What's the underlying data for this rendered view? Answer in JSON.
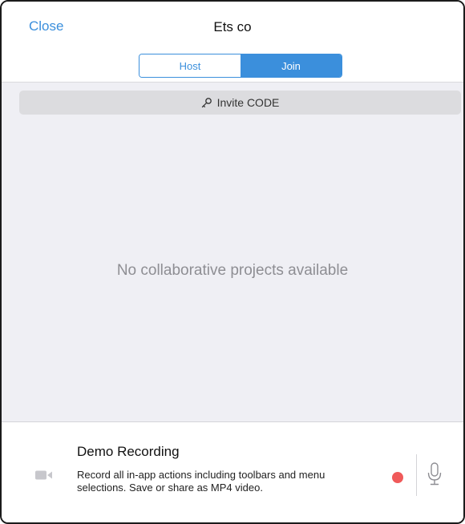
{
  "header": {
    "close_label": "Close",
    "title": "Ets co",
    "segments": [
      {
        "label": "Host",
        "selected": false
      },
      {
        "label": "Join",
        "selected": true
      }
    ]
  },
  "invite": {
    "label": "Invite CODE",
    "icon": "key-icon"
  },
  "empty_state": {
    "message": "No collaborative projects available"
  },
  "recording": {
    "title": "Demo Recording",
    "description": "Record all in-app actions including toolbars and menu selections. Save or share as MP4 video.",
    "camera_icon": "video-camera-icon",
    "record_icon": "record-dot-icon",
    "mic_icon": "microphone-icon"
  },
  "colors": {
    "accent": "#3b8fdc",
    "record": "#f05a5a",
    "content_bg": "#efeff4",
    "muted_text": "#8e8e93"
  }
}
